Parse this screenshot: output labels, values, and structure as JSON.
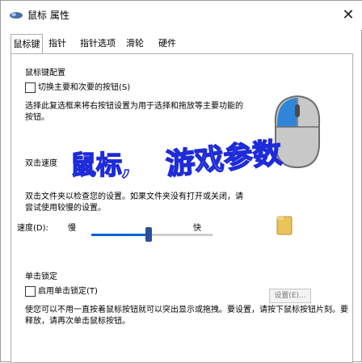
{
  "window": {
    "title": "鼠标 属性",
    "close_glyph": "✕"
  },
  "tabs": [
    {
      "label": "鼠标键"
    },
    {
      "label": "指针"
    },
    {
      "label": "指针选项"
    },
    {
      "label": "滑轮"
    },
    {
      "label": "硬件"
    }
  ],
  "switch_buttons": {
    "section_title": "鼠标键配置",
    "checkbox_label": "切换主要和次要的按钮(S)",
    "checked": false,
    "description": "选择此复选框来将右按钮设置为用于选择和拖放等主要功能的按钮。"
  },
  "banner": {
    "text_left": "鼠标,",
    "text_right": "游戏参数",
    "accent_color": "#1e2bd8"
  },
  "double_click": {
    "section_title": "双击速度",
    "description": "双击文件夹以检查您的设置。如果文件夹没有打开或关闭，请尝试使用较慢的设置。",
    "speed_label": "速度(D):",
    "slow_label": "慢",
    "fast_label": "快",
    "speed_fraction": 0.47
  },
  "click_lock": {
    "section_title": "单击锁定",
    "checkbox_label": "启用单击锁定(T)",
    "checked": false,
    "settings_button": "设置(E)...",
    "description": "使您可以不用一直按着鼠标按钮就可以突出显示或拖拽。要设置，请按下鼠标按钮片刻。要释放，请再次单击鼠标按钮。"
  },
  "colors": {
    "accent": "#0a64d2",
    "thumb": "#2a4f9a"
  }
}
